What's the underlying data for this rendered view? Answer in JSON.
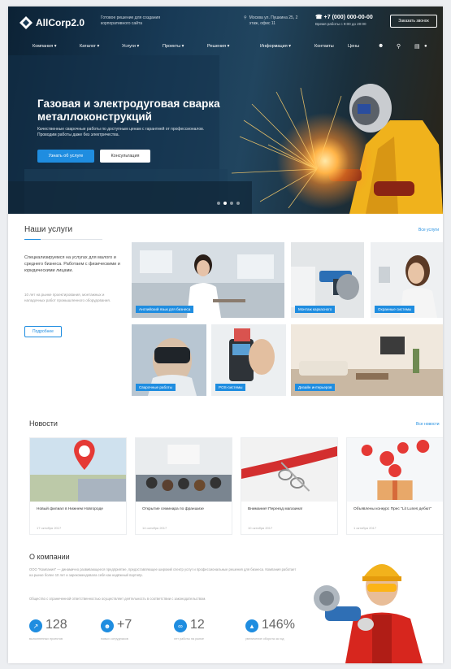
{
  "header": {
    "logo": "AllCorp2.0",
    "tagline": "Готовое решение для создания корпоративного сайта",
    "address": "Москва ул. Пушкина 25, 2 этаж, офис 11",
    "phone": "+7 (000) 000-00-00",
    "hours": "Время работы с 9:00 до 20:00",
    "callback": "Заказать звонок"
  },
  "nav": [
    "Компания",
    "Каталог",
    "Услуги",
    "Проекты",
    "Решения",
    "Информация",
    "Контакты",
    "Цены"
  ],
  "hero": {
    "title": "Газовая и электродуговая сварка металлоконструкций",
    "subtitle": "Качественные сварочные работы по доступным ценам с гарантией от профессионалов. Проводим работы даже без электричества.",
    "primary_button": "Узнать об услуге",
    "secondary_button": "Консультация",
    "slides": 4,
    "active_slide": 1
  },
  "services": {
    "title": "Наши услуги",
    "all_link": "Все услуги",
    "description": "Специализируемся на услугах для малого и среднего бизнеса. Работаем с физическими и юридическими лицами.",
    "description2": "10 лет на рынке проектирования, монтажных и наладочных работ промышленного оборудования.",
    "button": "Подробнее",
    "tiles": [
      {
        "label": "Английский язык для бизнеса"
      },
      {
        "label": "Монтаж каркасного"
      },
      {
        "label": "Охранные системы"
      },
      {
        "label": "Сварочные работы"
      },
      {
        "label": "POS-системы"
      },
      {
        "label": "Дизайн интерьеров"
      }
    ]
  },
  "news": {
    "title": "Новости",
    "all_link": "Все новости",
    "items": [
      {
        "title": "Новый филиал в Нижнем Новгороде",
        "date": "17 октября 2017"
      },
      {
        "title": "Открытие семинара по франшизе",
        "date": "14 октября 2017"
      },
      {
        "title": "Внимание! Переезд магазина!",
        "date": "10 октября 2017"
      },
      {
        "title": "Объявлены конкурс Прес \"Lit Lunes дебют\"",
        "date": "1 октября 2017"
      }
    ]
  },
  "about": {
    "title": "О компании",
    "text": "ООО \"Компания\" — динамично развивающееся предприятие, предоставляющее широкий спектр услуг и профессиональные решения для бизнеса. Компания работает на рынке более 10 лет и зарекомендовала себя как надёжный партнёр.",
    "text2": "Общество с ограниченной ответственностью осуществляет деятельность в соответствии с законодательством.",
    "stats": [
      {
        "value": "128",
        "caption": "выполненных проектов",
        "icon": "chart-icon"
      },
      {
        "value": "+7",
        "caption": "новых сотрудников",
        "icon": "people-icon"
      },
      {
        "value": "12",
        "caption": "лет работы на рынке",
        "icon": "infinity-icon"
      },
      {
        "value": "146%",
        "caption": "увеличение оборота за год",
        "icon": "growth-icon"
      }
    ]
  },
  "colors": {
    "accent": "#1f8de0",
    "hero_dark": "#0c2235",
    "spark": "#ffb347"
  }
}
